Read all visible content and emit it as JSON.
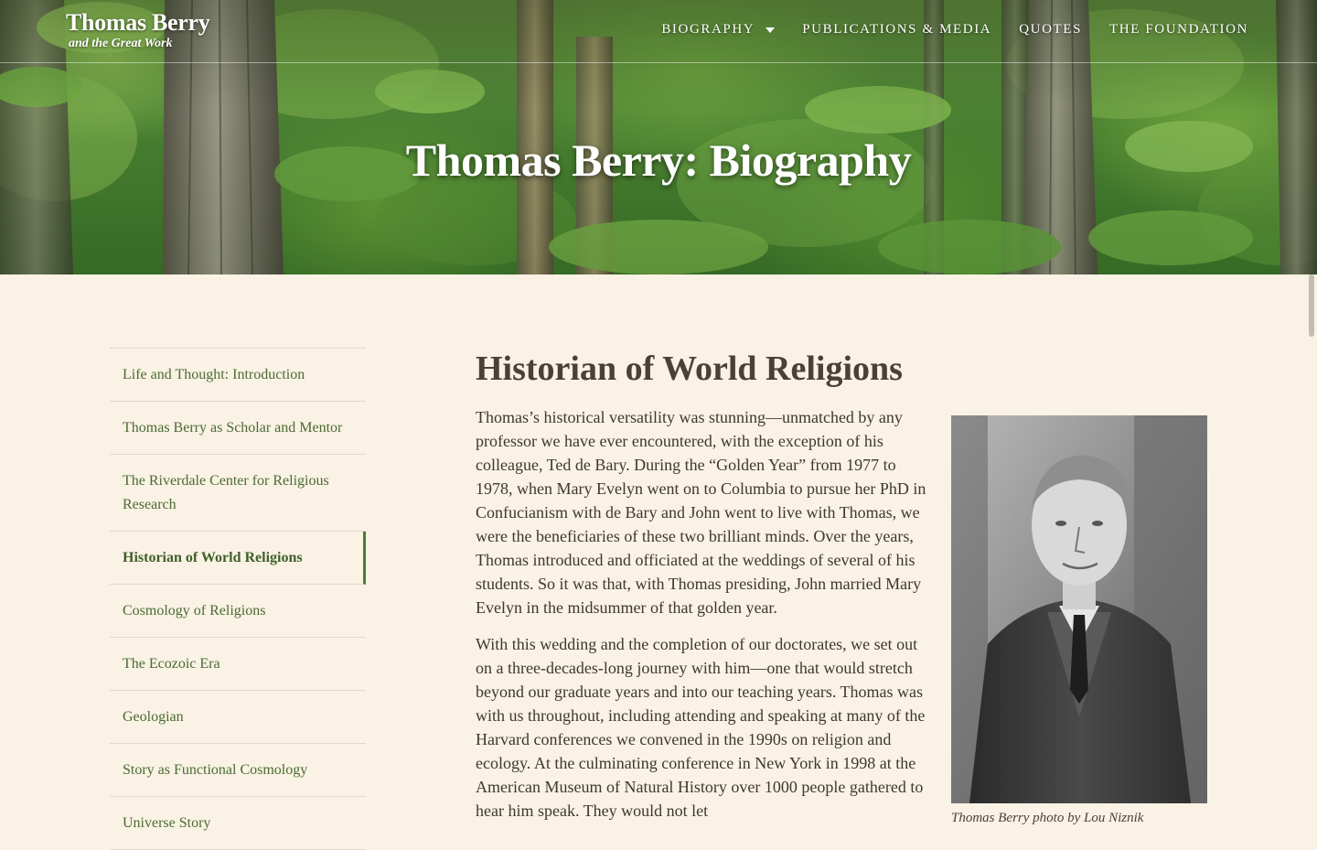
{
  "header": {
    "brand_title": "Thomas Berry",
    "brand_subtitle": "and the Great Work",
    "nav": [
      {
        "label": "BIOGRAPHY",
        "has_dropdown": true
      },
      {
        "label": "PUBLICATIONS & MEDIA"
      },
      {
        "label": "QUOTES"
      },
      {
        "label": "THE FOUNDATION"
      }
    ],
    "dropdown_icon": "caret-down-icon"
  },
  "hero": {
    "title": "Thomas Berry: Biography",
    "background": "forest-photo"
  },
  "sidebar": {
    "items": [
      {
        "label": "Life and Thought: Introduction",
        "active": false
      },
      {
        "label": "Thomas Berry as Scholar and Mentor",
        "active": false
      },
      {
        "label": "The Riverdale Center for Religious Research",
        "active": false
      },
      {
        "label": "Historian of World Religions",
        "active": true
      },
      {
        "label": "Cosmology of Religions",
        "active": false
      },
      {
        "label": "The Ecozoic Era",
        "active": false
      },
      {
        "label": "Geologian",
        "active": false
      },
      {
        "label": "Story as Functional Cosmology",
        "active": false
      },
      {
        "label": "Universe Story",
        "active": false
      }
    ]
  },
  "main": {
    "heading": "Historian of World Religions",
    "paragraphs": [
      "Thomas’s historical versatility was stunning—unmatched by any professor we have ever encountered, with the exception of his colleague, Ted de Bary. During the “Golden Year” from 1977 to 1978, when Mary Evelyn went on to Columbia to pursue her PhD in Confucianism with de Bary and John went to live with Thomas, we were the beneficiaries of these two brilliant minds. Over the years, Thomas introduced and officiated at the weddings of several of his students. So it was that, with Thomas presiding, John married Mary Evelyn in the midsummer of that golden year.",
      "With this wedding and the completion of our doctorates, we set out on a three-decades-long journey with him—one that would stretch beyond our graduate years and into our teaching years. Thomas was with us throughout, including attending and speaking at many of the Harvard conferences we convened in the 1990s on religion and ecology. At the culminating conference in New York in 1998 at the American Museum of Natural History over 1000 people gathered to hear him speak. They would not let"
    ],
    "photo": {
      "alt": "Black and white portrait of Thomas Berry",
      "caption": "Thomas Berry photo by Lou Niznik"
    }
  },
  "colors": {
    "background": "#faf2e4",
    "link_green": "#4a6b34",
    "active_border": "#4f7a35",
    "heading_text": "#4a4038",
    "body_text": "#3d3730"
  }
}
